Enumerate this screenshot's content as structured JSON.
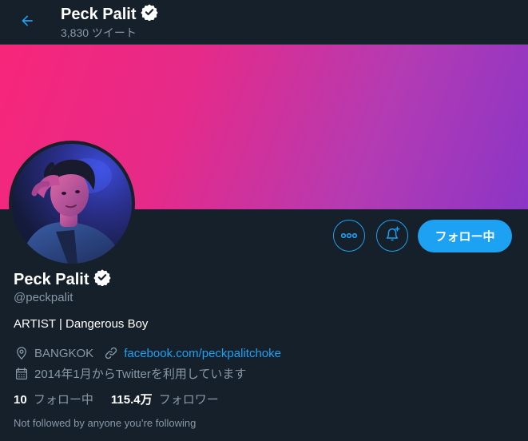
{
  "header": {
    "name": "Peck Palit",
    "tweet_count": "3,830 ツイート"
  },
  "profile": {
    "name": "Peck Palit",
    "handle": "@peckpalit",
    "bio": "ARTIST | Dangerous Boy",
    "location": "BANGKOK",
    "website": "facebook.com/peckpalitchoke",
    "joined": "2014年1月からTwitterを利用しています",
    "following_count": "10",
    "following_label": "フォロー中",
    "followers_count": "115.4万",
    "followers_label": "フォロワー",
    "followed_by_note": "Not followed by anyone you’re following"
  },
  "actions": {
    "follow_label": "フォロー中"
  },
  "colors": {
    "accent": "#1da1f2",
    "background": "#15202b",
    "muted_text": "#8899a6",
    "banner_start": "#f7267a",
    "banner_end": "#8b35c6"
  },
  "icons": {
    "back": "arrow-left-icon",
    "verified": "verified-badge-icon",
    "more": "more-horizontal-icon",
    "notify": "bell-plus-icon",
    "location": "location-pin-icon",
    "link": "link-icon",
    "calendar": "calendar-icon"
  }
}
